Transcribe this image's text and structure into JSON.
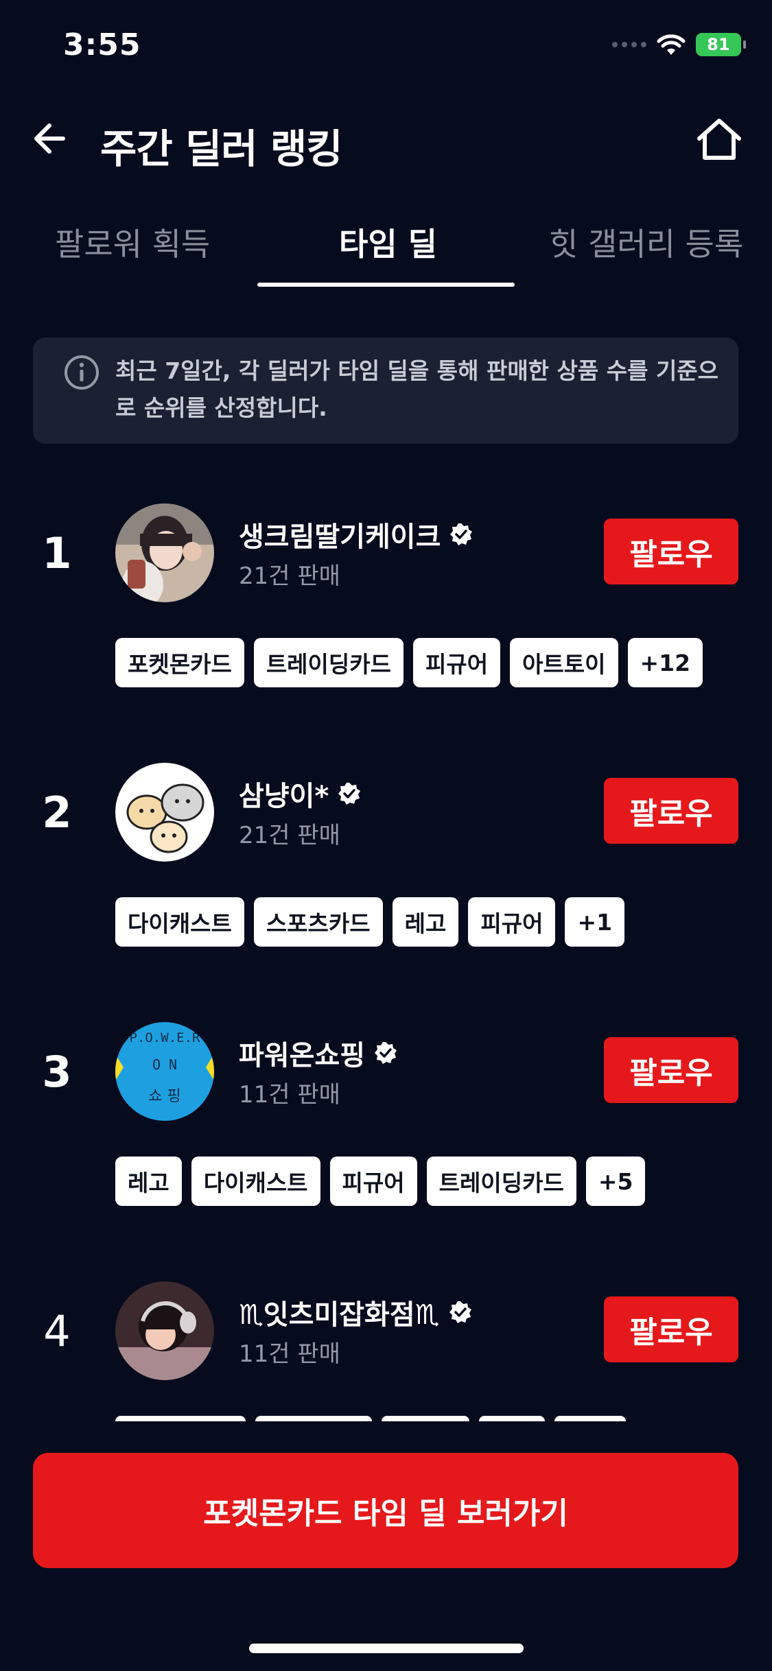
{
  "status_bar": {
    "time": "3:55",
    "battery": "81"
  },
  "header": {
    "title": "주간 딜러 랭킹"
  },
  "tabs": [
    {
      "label": "팔로워 획득"
    },
    {
      "label": "타임 딜"
    },
    {
      "label": "힛 갤러리 등록"
    }
  ],
  "active_tab_index": 1,
  "info": {
    "text": "최근 7일간, 각 딜러가 타임 딜을 통해 판매한 상품 수를 기준으로 순위를 산정합니다."
  },
  "dealers": [
    {
      "rank": "1",
      "name": "생크림딸기케이크",
      "sales": "21건 판매",
      "follow_label": "팔로우",
      "tags": [
        "포켓몬카드",
        "트레이딩카드",
        "피규어",
        "아트토이",
        "+12"
      ]
    },
    {
      "rank": "2",
      "name": "삼냥이*",
      "sales": "21건 판매",
      "follow_label": "팔로우",
      "tags": [
        "다이캐스트",
        "스포츠카드",
        "레고",
        "피규어",
        "+1"
      ]
    },
    {
      "rank": "3",
      "name": "파워온쇼핑",
      "sales": "11건 판매",
      "follow_label": "팔로우",
      "tags": [
        "레고",
        "다이캐스트",
        "피규어",
        "트레이딩카드",
        "+5"
      ],
      "avatar_text": {
        "line1": "P.O.W.E.R",
        "line2": "O N",
        "line3": "쇼 핑"
      }
    },
    {
      "rank": "4",
      "name": "♏잇츠미잡화점♏",
      "sales": "11건 판매",
      "follow_label": "팔로우",
      "tags": []
    }
  ],
  "cta": {
    "label": "포켓몬카드 타임 딜 보러가기"
  },
  "colors": {
    "background": "#070b1e",
    "accent": "#e5191b",
    "info_box": "#1b2133",
    "muted_text": "#8b8e9b"
  }
}
